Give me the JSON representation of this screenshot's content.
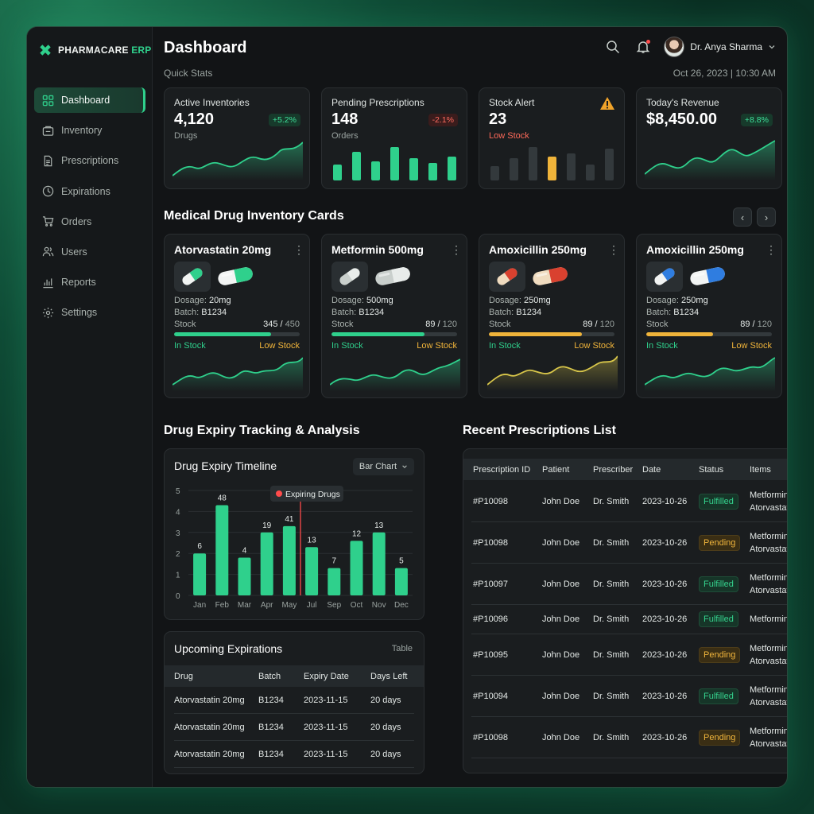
{
  "brand": {
    "name": "PHARMACARE",
    "suffix": "ERP"
  },
  "sidebar": {
    "items": [
      {
        "label": "Dashboard",
        "icon": "grid-icon"
      },
      {
        "label": "Inventory",
        "icon": "box-icon"
      },
      {
        "label": "Prescriptions",
        "icon": "document-icon"
      },
      {
        "label": "Expirations",
        "icon": "clock-icon"
      },
      {
        "label": "Orders",
        "icon": "cart-icon"
      },
      {
        "label": "Users",
        "icon": "users-icon"
      },
      {
        "label": "Reports",
        "icon": "bar-chart-icon"
      },
      {
        "label": "Settings",
        "icon": "gear-icon"
      }
    ]
  },
  "header": {
    "title": "Dashboard",
    "subtitle": "Quick Stats",
    "datetime": "Oct 26, 2023 | 10:30 AM",
    "user_name": "Dr. Anya Sharma"
  },
  "stats": [
    {
      "label": "Active Inventories",
      "value": "4,120",
      "sub": "Drugs",
      "badge": "+5.2%"
    },
    {
      "label": "Pending Prescriptions",
      "value": "148",
      "sub": "Orders",
      "badge": "-2.1%"
    },
    {
      "label": "Stock Alert",
      "value": "23",
      "sub": "Low Stock",
      "badge": ""
    },
    {
      "label": "Today's Revenue",
      "value": "$8,450.00",
      "sub": "",
      "badge": "+8.8%"
    }
  ],
  "inventory_section": {
    "title": "Medical Drug Inventory Cards",
    "prev": "‹",
    "next": "›"
  },
  "drug_cards": [
    {
      "name": "Atorvastatin 20mg",
      "dosage_label": "Dosage:",
      "dosage": "20mg",
      "batch_label": "Batch:",
      "batch": "B1234",
      "stock_label": "Stock",
      "stock": "345",
      "total": "450",
      "fill": 0.77,
      "bar_color": "#2fd08c",
      "in_label": "In Stock",
      "low_label": "Low Stock",
      "pill_colors": [
        "#2fd08c",
        "#f2f4f3"
      ],
      "trend_color": "#2fd08c"
    },
    {
      "name": "Metformin 500mg",
      "dosage_label": "Dosage:",
      "dosage": "500mg",
      "batch_label": "Batch:",
      "batch": "B1234",
      "stock_label": "Stock",
      "stock": "89",
      "total": "120",
      "fill": 0.74,
      "bar_color": "#2fd08c",
      "in_label": "In Stock",
      "low_label": "Low Stock",
      "pill_colors": [
        "#e8ecea",
        "#c9cfcc"
      ],
      "trend_color": "#2fd08c"
    },
    {
      "name": "Amoxicillin 250mg",
      "dosage_label": "Dosage:",
      "dosage": "250mg",
      "batch_label": "Batch:",
      "batch": "B1234",
      "stock_label": "Stock",
      "stock": "89",
      "total": "120",
      "fill": 0.74,
      "bar_color": "#f0b43a",
      "in_label": "In Stock",
      "low_label": "Low Stock",
      "pill_colors": [
        "#d9412f",
        "#f0dcc0"
      ],
      "trend_color": "#d8c64a"
    },
    {
      "name": "Amoxicillin 250mg",
      "dosage_label": "Dosage:",
      "dosage": "250mg",
      "batch_label": "Batch:",
      "batch": "B1234",
      "stock_label": "Stock",
      "stock": "89",
      "total": "120",
      "fill": 0.53,
      "bar_color": "#f0b43a",
      "in_label": "In Stock",
      "low_label": "Low Stock",
      "pill_colors": [
        "#2f7de0",
        "#f2f4f3"
      ],
      "trend_color": "#2fd08c"
    }
  ],
  "expiry_section": {
    "title": "Drug Expiry Tracking & Analysis"
  },
  "expiry_chart": {
    "title": "Drug Expiry Timeline",
    "mode": "Bar Chart",
    "tooltip": "Expiring Drugs"
  },
  "chart_data": {
    "type": "bar",
    "title": "Drug Expiry Timeline",
    "categories": [
      "Jan",
      "Feb",
      "Mar",
      "Apr",
      "May",
      "Jul",
      "Sep",
      "Oct",
      "Nov",
      "Dec"
    ],
    "values": [
      6,
      48,
      4,
      19,
      41,
      13,
      7,
      12,
      13,
      5
    ],
    "bar_heights_axis_units": [
      2,
      4.3,
      1.8,
      3,
      3.3,
      2.3,
      1.3,
      2.6,
      3,
      1.3
    ],
    "y_ticks": [
      "0",
      "1",
      "2",
      "3",
      "4",
      "5"
    ],
    "ylim": [
      0,
      5
    ],
    "marker_after": "May",
    "grid": true,
    "color": "#2fd08c"
  },
  "upcoming": {
    "title": "Upcoming Expirations",
    "tag": "Table",
    "columns": [
      "Drug",
      "Batch",
      "Expiry Date",
      "Days Left"
    ],
    "rows": [
      [
        "Atorvastatin 20mg",
        "B1234",
        "2023-11-15",
        "20 days"
      ],
      [
        "Atorvastatin 20mg",
        "B1234",
        "2023-11-15",
        "20 days"
      ],
      [
        "Atorvastatin 20mg",
        "B1234",
        "2023-11-15",
        "20 days"
      ]
    ]
  },
  "prescriptions": {
    "title": "Recent Prescriptions List",
    "columns": [
      "Prescription ID",
      "Patient",
      "Prescriber",
      "Date",
      "Status",
      "Items"
    ],
    "rows": [
      {
        "id": "#P10098",
        "patient": "John Doe",
        "prescriber": "Dr. Smith",
        "date": "2023-10-26",
        "status": "Fulfilled",
        "items": [
          "Metformin",
          "Atorvastatin"
        ]
      },
      {
        "id": "#P10098",
        "patient": "John Doe",
        "prescriber": "Dr. Smith",
        "date": "2023-10-26",
        "status": "Pending",
        "items": [
          "Metformin",
          "Atorvastatin"
        ]
      },
      {
        "id": "#P10097",
        "patient": "John Doe",
        "prescriber": "Dr. Smith",
        "date": "2023-10-26",
        "status": "Fulfilled",
        "items": [
          "Metformin",
          "Atorvastatin"
        ]
      },
      {
        "id": "#P10096",
        "patient": "John Doe",
        "prescriber": "Dr. Smith",
        "date": "2023-10-26",
        "status": "Fulfilled",
        "items": [
          "Metformin"
        ]
      },
      {
        "id": "#P10095",
        "patient": "John Doe",
        "prescriber": "Dr. Smith",
        "date": "2023-10-26",
        "status": "Pending",
        "items": [
          "Metformin",
          "Atorvastatin"
        ]
      },
      {
        "id": "#P10094",
        "patient": "John Doe",
        "prescriber": "Dr. Smith",
        "date": "2023-10-26",
        "status": "Fulfilled",
        "items": [
          "Metformin",
          "Atorvastatin"
        ]
      },
      {
        "id": "#P10098",
        "patient": "John Doe",
        "prescriber": "Dr. Smith",
        "date": "2023-10-26",
        "status": "Pending",
        "items": [
          "Metformin",
          "Atorvastatin"
        ]
      }
    ]
  },
  "colors": {
    "accent": "#2fd08c",
    "warning": "#f0b43a",
    "danger": "#ff5a4e",
    "panel": "#1a1d1f"
  }
}
